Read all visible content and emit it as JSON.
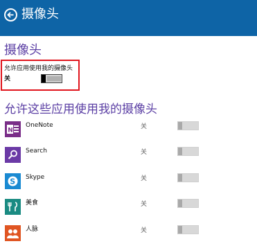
{
  "header": {
    "title": "摄像头",
    "back_icon": "back-arrow-icon",
    "bg_color": "#0e64a6"
  },
  "section": {
    "title": "摄像头"
  },
  "master": {
    "label": "允许应用使用我的摄像头",
    "state": "关"
  },
  "apps_section": {
    "title": "允许这些应用使用我的摄像头"
  },
  "apps": [
    {
      "name": "OneNote",
      "state": "关",
      "icon": "onenote-icon",
      "color": "#7a2e88"
    },
    {
      "name": "Search",
      "state": "关",
      "icon": "search-icon",
      "color": "#6b3aa6"
    },
    {
      "name": "Skype",
      "state": "关",
      "icon": "skype-icon",
      "color": "#1a8ad2"
    },
    {
      "name": "美食",
      "state": "关",
      "icon": "food-icon",
      "color": "#1a8b82"
    },
    {
      "name": "人脉",
      "state": "关",
      "icon": "people-icon",
      "color": "#e05522"
    }
  ]
}
